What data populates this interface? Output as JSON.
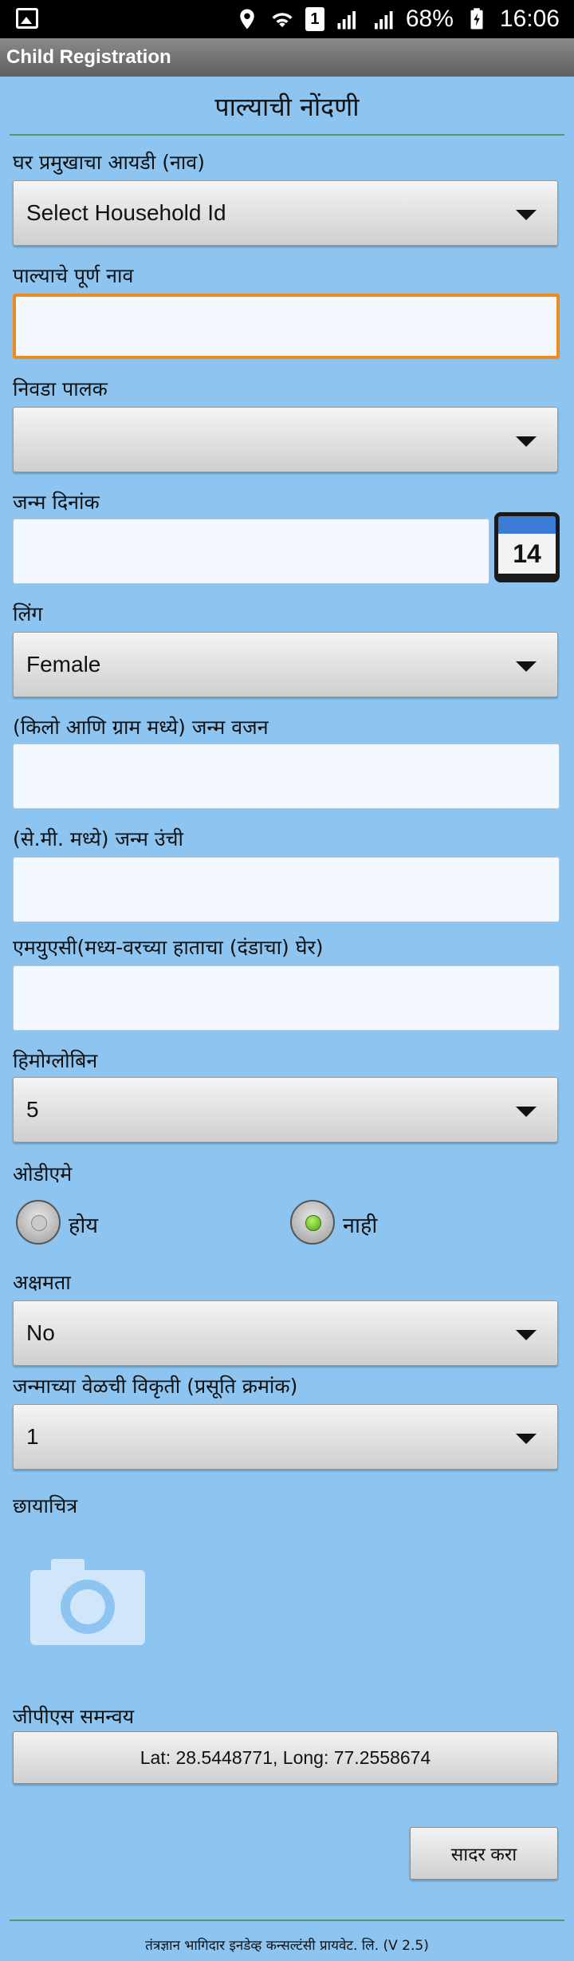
{
  "status_bar": {
    "battery": "68%",
    "time": "16:06",
    "sim": "1",
    "network": "R"
  },
  "app": {
    "title": "Child Registration"
  },
  "form": {
    "heading": "पाल्याची नोंदणी",
    "household_label": "घर प्रमुखाचा आयडी (नाव)",
    "household_value": "Select Household Id",
    "child_name_label": "पाल्याचे पूर्ण नाव",
    "child_name_value": "",
    "guardian_label": "निवडा पालक",
    "guardian_value": "",
    "dob_label": "जन्म दिनांक",
    "dob_value": "",
    "calendar_day": "14",
    "gender_label": "लिंग",
    "gender_value": "Female",
    "birth_weight_label": "(किलो आणि ग्राम मध्ये) जन्म वजन",
    "birth_weight_value": "",
    "birth_height_label": "(से.मी. मध्ये) जन्म उंची",
    "birth_height_value": "",
    "muac_label": "एमयुएसी(मध्य-वरच्या हाताचा (दंडाचा) घेर)",
    "muac_value": "",
    "hemoglobin_label": "हिमोग्लोबिन",
    "hemoglobin_value": "5",
    "odiem_label": "ओडीएमे",
    "odiem_yes": "होय",
    "odiem_no": "नाही",
    "odiem_selected": "नाही",
    "disability_label": "अक्षमता",
    "disability_value": "No",
    "birth_defect_label": "जन्माच्या वेळची विकृती (प्रसूति क्रमांक)",
    "birth_defect_value": "1",
    "photo_label": "छायाचित्र",
    "gps_label": "जीपीएस समन्वय",
    "gps_value": "Lat: 28.5448771, Long: 77.2558674",
    "submit_label": "सादर करा"
  },
  "footer": "तंत्रज्ञान भागिदार इनडेव्ह कन्सल्टंसी प्रायवेट. लि. (V 2.5)",
  "colors": {
    "background": "#8dc5f0",
    "focus_border": "#f08a1c",
    "rule": "#4f9a6d"
  }
}
